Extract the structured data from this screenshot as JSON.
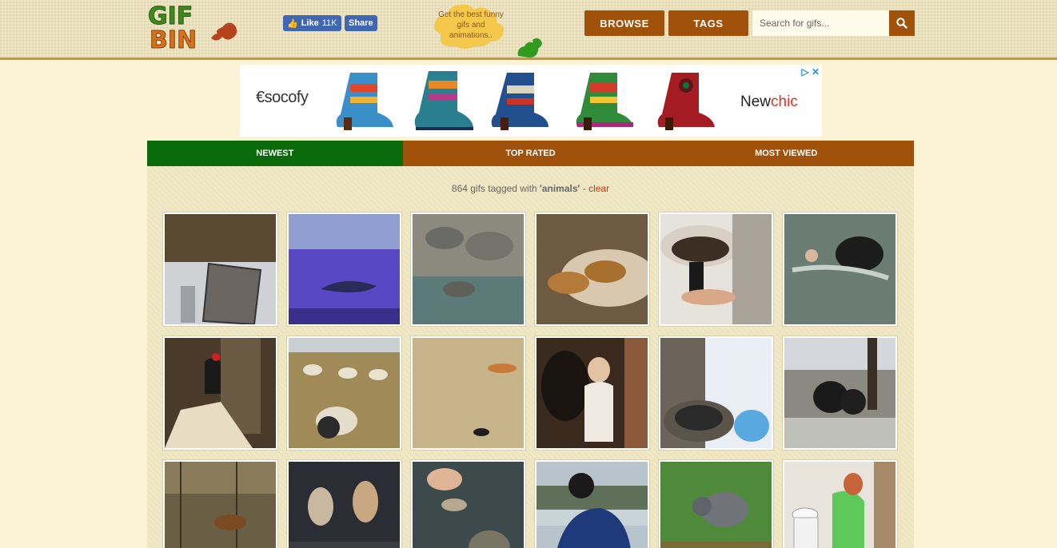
{
  "header": {
    "fb_like_label": "Like",
    "fb_like_count": "11K",
    "fb_share_label": "Share",
    "tagline": "Get the best funny gifs and animations..",
    "nav": {
      "browse_label": "BROWSE",
      "tags_label": "TAGS"
    },
    "search": {
      "placeholder": "Search for gifs..."
    }
  },
  "ad": {
    "left_brand": "socofy",
    "right_brand_a": "New",
    "right_brand_b": "chic",
    "choices": "▷ ✕"
  },
  "tabs": [
    {
      "label": "NEWEST",
      "active": true
    },
    {
      "label": "TOP RATED",
      "active": false
    },
    {
      "label": "MOST VIEWED",
      "active": false
    }
  ],
  "results": {
    "count_text": "864 gifs tagged with ",
    "tag": "'animals'",
    "separator": " - ",
    "clear_label": "clear"
  },
  "gifs": [
    {
      "scene": "patio chair"
    },
    {
      "scene": "shark aquarium"
    },
    {
      "scene": "elephants zoo"
    },
    {
      "scene": "lions walking"
    },
    {
      "scene": "bowl with drink"
    },
    {
      "scene": "dog in water"
    },
    {
      "scene": "woodpecker tree"
    },
    {
      "scene": "sheep in field"
    },
    {
      "scene": "tiger and duck"
    },
    {
      "scene": "woman and horse"
    },
    {
      "scene": "nest on gutter"
    },
    {
      "scene": "bear cubs fence"
    },
    {
      "scene": "dog by fence"
    },
    {
      "scene": "dogs walking"
    },
    {
      "scene": "hand feeding fish"
    },
    {
      "scene": "man on boat"
    },
    {
      "scene": "cat in grass"
    },
    {
      "scene": "woman bathroom"
    }
  ],
  "colors": {
    "brand_brown": "#a0520a",
    "brand_green": "#0a6a0a",
    "background": "#faf3d6"
  }
}
